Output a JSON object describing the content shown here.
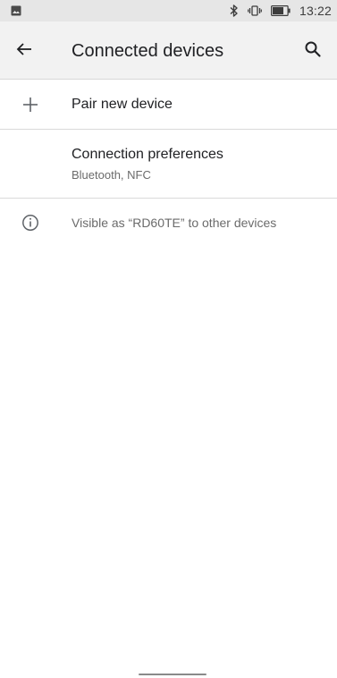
{
  "status_bar": {
    "time": "13:22",
    "icons": [
      "image-icon",
      "bluetooth-icon",
      "vibrate-icon",
      "battery-icon"
    ]
  },
  "app_bar": {
    "title": "Connected devices",
    "back_icon": "arrow-back-icon",
    "search_icon": "search-icon"
  },
  "list": {
    "pair_new_device": {
      "icon": "plus-icon",
      "title": "Pair new device"
    },
    "connection_preferences": {
      "title": "Connection preferences",
      "subtitle": "Bluetooth, NFC"
    },
    "visible_as": {
      "icon": "info-icon",
      "text": "Visible as “RD60TE” to other devices"
    }
  },
  "colors": {
    "status_bar_bg": "#e6e6e6",
    "app_bar_bg": "#f2f2f2",
    "divider": "#dadada",
    "primary_text": "#202124",
    "secondary_text": "#6b6b6b"
  }
}
